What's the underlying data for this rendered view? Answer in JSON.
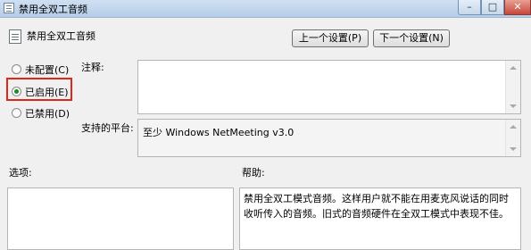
{
  "window": {
    "title": "禁用全双工音频"
  },
  "header": {
    "title": "禁用全双工音频",
    "prev_button": "上一个设置(P)",
    "next_button": "下一个设置(N)"
  },
  "radios": [
    {
      "label": "未配置(C)",
      "checked": false
    },
    {
      "label": "已启用(E)",
      "checked": true
    },
    {
      "label": "已禁用(D)",
      "checked": false
    }
  ],
  "comment": {
    "label": "注释:",
    "value": ""
  },
  "platform": {
    "label": "支持的平台:",
    "value": "至少 Windows NetMeeting v3.0"
  },
  "options": {
    "label": "选项:"
  },
  "help": {
    "label": "帮助:",
    "text": "禁用全双工模式音频。这样用户就不能在用麦克风说话的同时收听传入的音频。旧式的音频硬件在全双工模式中表现不佳。"
  }
}
